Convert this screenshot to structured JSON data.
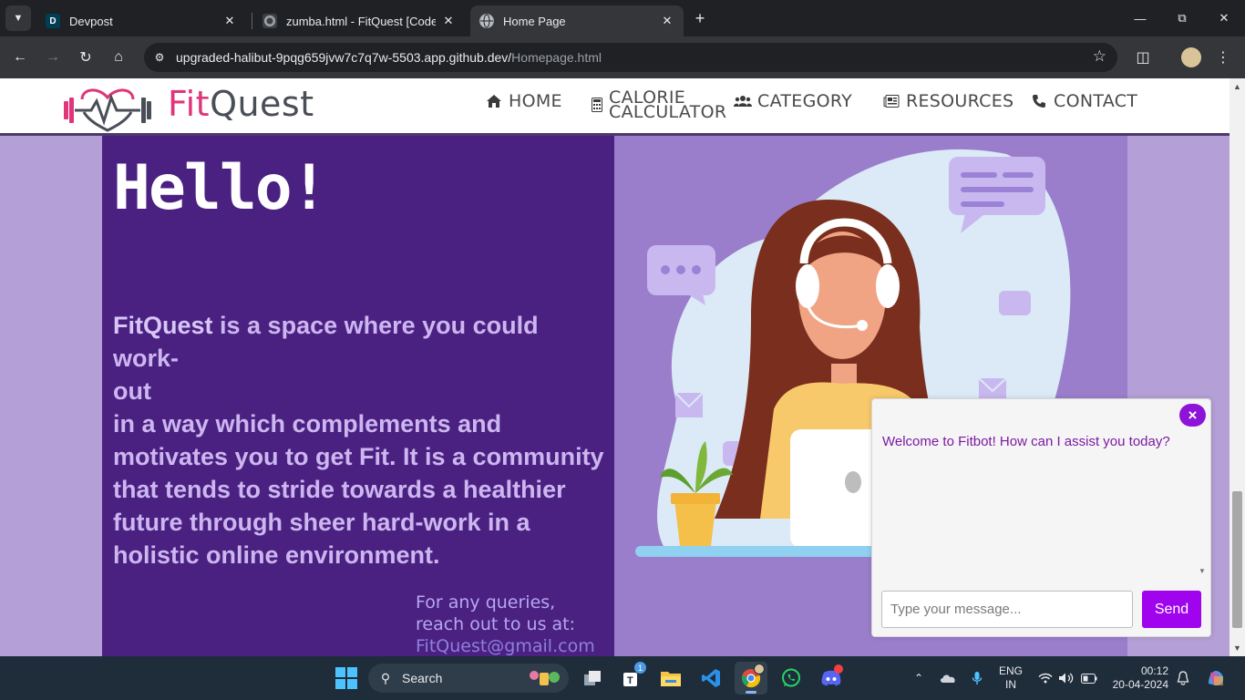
{
  "browser": {
    "tabs": [
      {
        "title": "Devpost",
        "favicon_letter": "D"
      },
      {
        "title": "zumba.html - FitQuest [Codesp"
      },
      {
        "title": "Home Page",
        "active": true
      }
    ],
    "new_tab": "+",
    "url_host": "upgraded-halibut-9pqg659jvw7c7q7w-5503.app.github.dev/",
    "url_path": "Homepage.html"
  },
  "site": {
    "logo": {
      "fit": "Fit",
      "quest": "Quest"
    },
    "nav": [
      {
        "label": "HOME",
        "icon": "home-icon"
      },
      {
        "label": "CALORIE",
        "label2": "CALCULATOR",
        "icon": "calculator-icon"
      },
      {
        "label": "CATEGORY",
        "icon": "users-icon"
      },
      {
        "label": "RESOURCES",
        "icon": "newspaper-icon"
      },
      {
        "label": "CONTACT",
        "icon": "phone-icon"
      }
    ],
    "hero": {
      "title": "Hello!",
      "brand": "FitQuest",
      "line1_rest": " is a space where you could work-",
      "line2": "out",
      "body": "in a way which complements and motivates you to get Fit. It is a community that tends to stride towards a healthier future through sheer hard-work in a holistic online environment."
    },
    "contact": {
      "line1": "For any queries,",
      "line2": "reach out to us at:",
      "email": "FitQuest@gmail.com"
    }
  },
  "chatbot": {
    "close": "×",
    "welcome": "Welcome to Fitbot! How can I assist you today?",
    "placeholder": "Type your message...",
    "send": "Send"
  },
  "taskbar": {
    "search_label": "Search",
    "teams_badge": "1",
    "lang1": "ENG",
    "lang2": "IN",
    "time": "00:12",
    "date": "20-04-2024"
  },
  "colors": {
    "brand_pink": "#e0357a",
    "brand_grey": "#4a4e57",
    "hero_bg": "#4a2181",
    "page_bg": "#b49fd6",
    "send_button": "#a003ee"
  }
}
